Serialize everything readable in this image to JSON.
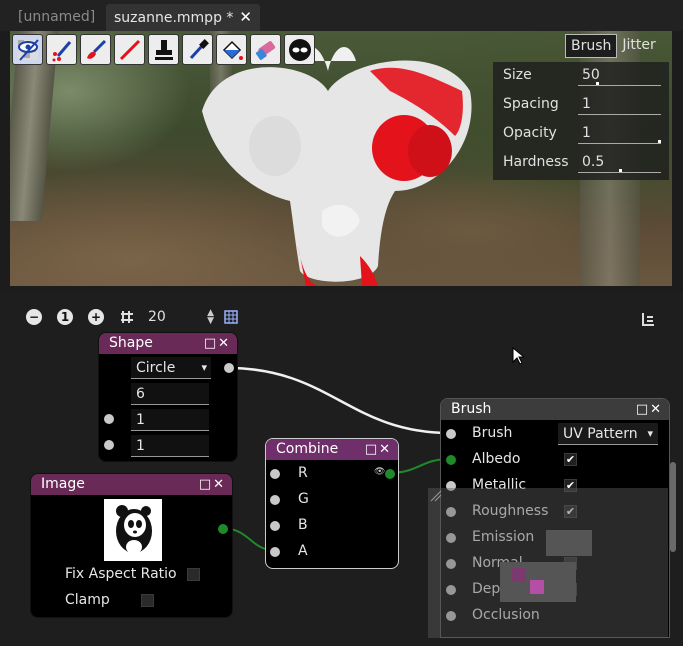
{
  "tabs": [
    {
      "label": "[unnamed]",
      "active": false
    },
    {
      "label": "suzanne.mmpp *",
      "active": true,
      "close": "✕"
    }
  ],
  "toolbar": {
    "tools": [
      "eye-toggle",
      "brush-dots",
      "brush-paint",
      "line",
      "stamp",
      "eyedropper",
      "fill-bucket",
      "eraser",
      "mask"
    ],
    "selected": "eye-toggle"
  },
  "brush_panel": {
    "tabs": [
      "Brush",
      "Jitter"
    ],
    "active_tab": "Brush",
    "params": [
      {
        "label": "Size",
        "value": "50",
        "level": 0.22
      },
      {
        "label": "Spacing",
        "value": "1",
        "level": 0.0
      },
      {
        "label": "Opacity",
        "value": "1",
        "level": 1.0
      },
      {
        "label": "Hardness",
        "value": "0.5",
        "level": 0.5
      }
    ]
  },
  "graph_toolbar": {
    "zoom_out": "−",
    "reset": "1",
    "zoom_in": "+",
    "grid_value": "20"
  },
  "nodes": {
    "shape": {
      "title": "Shape",
      "controls": "□✕",
      "shape_value": "Circle",
      "sides": "6",
      "value1": "1",
      "value2": "1"
    },
    "image": {
      "title": "Image",
      "controls": "□✕",
      "fix_aspect_label": "Fix Aspect Ratio",
      "clamp_label": "Clamp"
    },
    "combine": {
      "title": "Combine",
      "controls": "□✕",
      "inputs": [
        "R",
        "G",
        "B",
        "A"
      ]
    },
    "brush": {
      "title": "Brush",
      "controls": "□✕",
      "mode": "UV Pattern",
      "inputs": [
        "Brush",
        "Albedo",
        "Metallic",
        "Roughness",
        "Emission",
        "Normal",
        "Depth",
        "Occlusion"
      ],
      "checks": [
        true,
        true,
        true,
        false,
        false,
        false,
        false
      ]
    }
  },
  "colors": {
    "accent_purple": "#6a2a57",
    "port_green": "#1f8a2a",
    "paint_red": "#e3121b"
  }
}
